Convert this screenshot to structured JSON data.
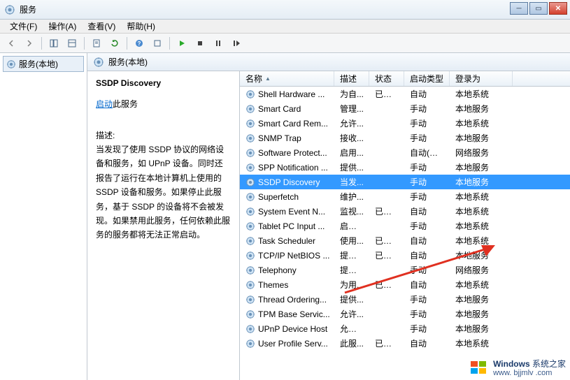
{
  "titlebar": {
    "title": "服务"
  },
  "menubar": {
    "file": "文件(F)",
    "action": "操作(A)",
    "view": "查看(V)",
    "help": "帮助(H)"
  },
  "tree": {
    "root": "服务(本地)"
  },
  "pane_header": {
    "label": "服务(本地)"
  },
  "detail": {
    "service_name": "SSDP Discovery",
    "start_link": "启动",
    "start_suffix": "此服务",
    "desc_label": "描述:",
    "desc_text": "当发现了使用 SSDP 协议的网络设备和服务，如 UPnP 设备。同时还报告了运行在本地计算机上使用的 SSDP 设备和服务。如果停止此服务，基于 SSDP 的设备将不会被发现。如果禁用此服务，任何依赖此服务的服务都将无法正常启动。"
  },
  "columns": {
    "name": "名称",
    "desc": "描述",
    "status": "状态",
    "startup": "启动类型",
    "logon": "登录为"
  },
  "services": [
    {
      "name": "Shell Hardware ...",
      "desc": "为自...",
      "status": "已启动",
      "startup": "自动",
      "logon": "本地系统"
    },
    {
      "name": "Smart Card",
      "desc": "管理...",
      "status": "",
      "startup": "手动",
      "logon": "本地服务"
    },
    {
      "name": "Smart Card Rem...",
      "desc": "允许...",
      "status": "",
      "startup": "手动",
      "logon": "本地系统"
    },
    {
      "name": "SNMP Trap",
      "desc": "接收...",
      "status": "",
      "startup": "手动",
      "logon": "本地服务"
    },
    {
      "name": "Software Protect...",
      "desc": "启用...",
      "status": "",
      "startup": "自动(延迟...",
      "logon": "网络服务"
    },
    {
      "name": "SPP Notification ...",
      "desc": "提供...",
      "status": "",
      "startup": "手动",
      "logon": "本地服务"
    },
    {
      "name": "SSDP Discovery",
      "desc": "当发...",
      "status": "",
      "startup": "手动",
      "logon": "本地服务",
      "selected": true
    },
    {
      "name": "Superfetch",
      "desc": "维护...",
      "status": "",
      "startup": "手动",
      "logon": "本地系统"
    },
    {
      "name": "System Event N...",
      "desc": "监视...",
      "status": "已启动",
      "startup": "自动",
      "logon": "本地系统"
    },
    {
      "name": "Tablet PC Input ...",
      "desc": "启用 ...",
      "status": "",
      "startup": "手动",
      "logon": "本地系统"
    },
    {
      "name": "Task Scheduler",
      "desc": "使用...",
      "status": "已启动",
      "startup": "自动",
      "logon": "本地系统"
    },
    {
      "name": "TCP/IP NetBIOS ...",
      "desc": "提供 ...",
      "status": "已启动",
      "startup": "自动",
      "logon": "本地服务"
    },
    {
      "name": "Telephony",
      "desc": "提供 ...",
      "status": "",
      "startup": "手动",
      "logon": "网络服务"
    },
    {
      "name": "Themes",
      "desc": "为用...",
      "status": "已启动",
      "startup": "自动",
      "logon": "本地系统"
    },
    {
      "name": "Thread Ordering...",
      "desc": "提供...",
      "status": "",
      "startup": "手动",
      "logon": "本地服务"
    },
    {
      "name": "TPM Base Servic...",
      "desc": "允许...",
      "status": "",
      "startup": "手动",
      "logon": "本地服务"
    },
    {
      "name": "UPnP Device Host",
      "desc": "允许 ...",
      "status": "",
      "startup": "手动",
      "logon": "本地服务"
    },
    {
      "name": "User Profile Serv...",
      "desc": "此服...",
      "status": "已启动",
      "startup": "自动",
      "logon": "本地系统"
    }
  ],
  "watermark": {
    "brand": "Windows",
    "sub": "系统之家",
    "url": "www. bjjmlv .com"
  }
}
